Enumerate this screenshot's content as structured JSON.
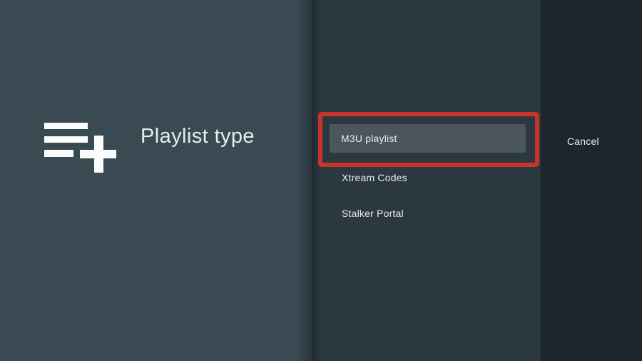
{
  "dialog": {
    "title": "Playlist type",
    "icon": "playlist-add-icon"
  },
  "actions": [
    {
      "label": "M3U playlist",
      "state": "focused",
      "annotated": true
    },
    {
      "label": "Xtream Codes",
      "state": "normal",
      "annotated": false
    },
    {
      "label": "Stalker Portal",
      "state": "normal",
      "annotated": false
    }
  ],
  "buttons": {
    "cancel_label": "Cancel"
  },
  "annotation": {
    "type": "highlight-box",
    "target": "M3U playlist"
  },
  "colors": {
    "left_panel_bg": "#3a4a52",
    "middle_panel_bg": "#2b3840",
    "right_panel_bg": "#1d262c",
    "focused_item_bg": "#4a555c",
    "annotation_red": "#c8342b",
    "text_primary": "#e9eced",
    "icon_white": "#fbfcfc"
  }
}
